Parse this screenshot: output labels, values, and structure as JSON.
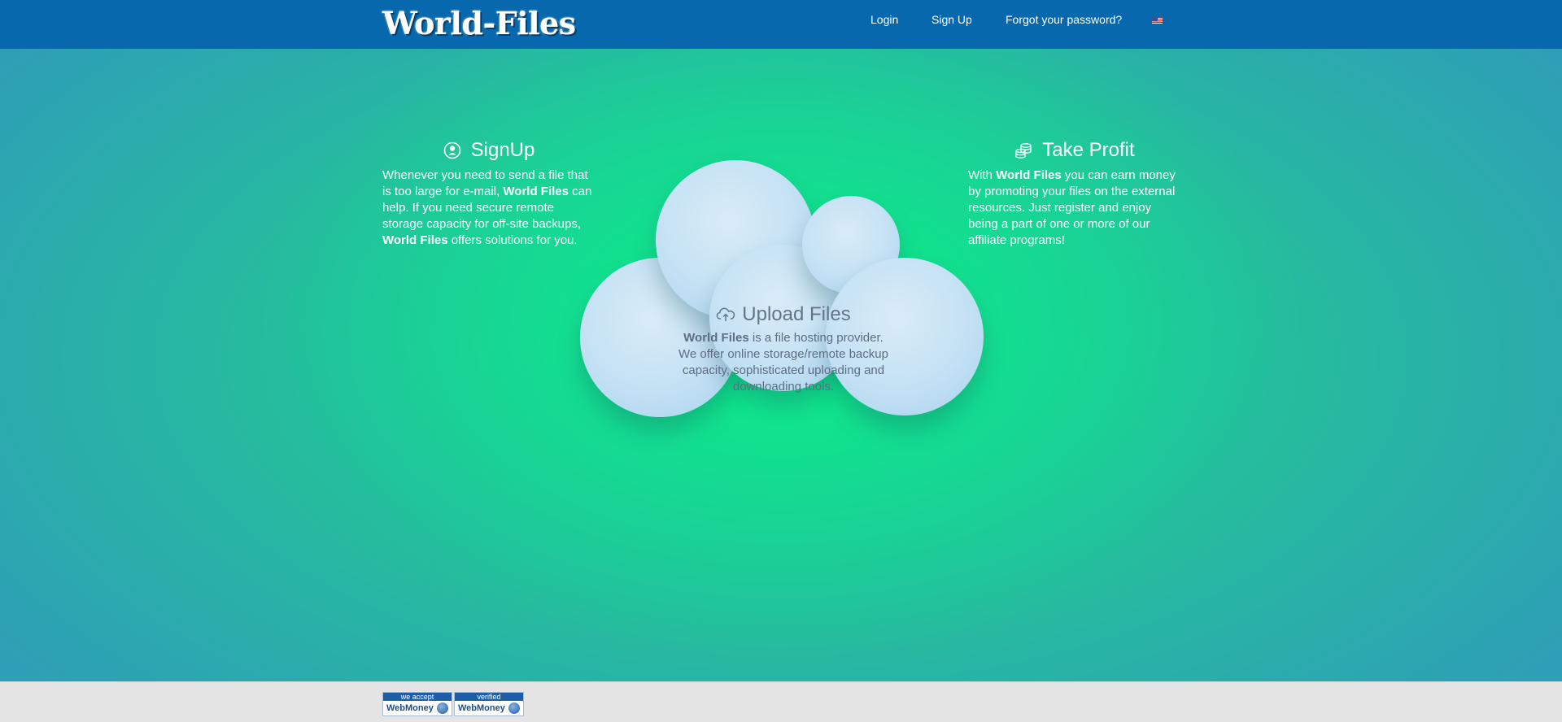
{
  "header": {
    "logo": "World-Files",
    "nav": {
      "login": "Login",
      "signup": "Sign Up",
      "forgot": "Forgot your password?"
    },
    "language_icon": "us-flag-icon"
  },
  "features": {
    "signup": {
      "title": "SignUp",
      "icon": "user-icon",
      "text_1": "Whenever you need to send a file that is too large for e-mail,",
      "brand_1": "World Files",
      "text_2": "can help. If you need secure remote storage capacity for off-site backups,",
      "brand_2": "World Files",
      "text_3": "offers solutions for you."
    },
    "upload": {
      "title": "Upload Files",
      "icon": "cloud-upload-icon",
      "brand": "World Files",
      "text": "is a file hosting provider. We offer online storage/remote backup capacity, sophisticated uploading and downloading tools."
    },
    "profit": {
      "title": "Take Profit",
      "icon": "coins-icon",
      "text_1": "With",
      "brand": "World Files",
      "text_2": "you can earn money by promoting your files on the external resources. Just register and enjoy being a part of one or more of our affiliate programs!"
    }
  },
  "footer": {
    "badges": [
      {
        "top": "we accept",
        "bottom": "WebMoney"
      },
      {
        "top": "verified",
        "bottom": "WebMoney"
      }
    ]
  },
  "colors": {
    "header_bg": "#0768ae",
    "accent_green": "#0ded8a",
    "cloud": "#c4e1f4",
    "footer_bg": "#e4e4e4"
  }
}
